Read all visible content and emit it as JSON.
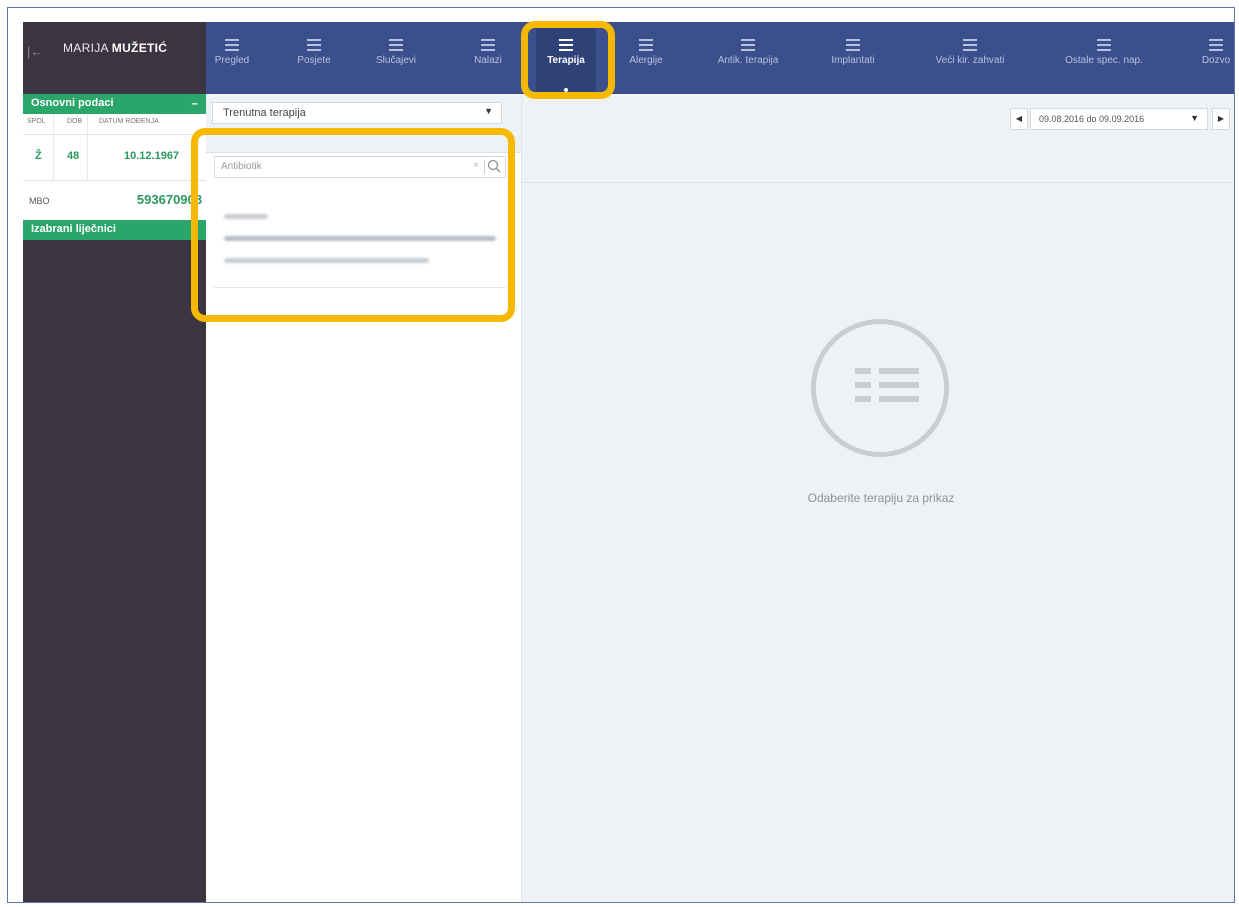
{
  "patient": {
    "first_name": "MARIJA",
    "last_name": "MUŽETIĆ"
  },
  "sidebar": {
    "basic_section": {
      "title": "Osnovni podaci",
      "toggle": "–"
    },
    "table_headers": [
      "SPOL",
      "DOB",
      "DATUM ROĐENJA"
    ],
    "sex": "Ž",
    "age": "48",
    "birth_date": "10.12.1967",
    "mbo_label": "MBO",
    "mbo_value": "593670908",
    "doctors_section": {
      "title": "Izabrani liječnici",
      "toggle": "+"
    }
  },
  "nav": {
    "items": [
      {
        "label": "Pregled",
        "icon": "list-icon"
      },
      {
        "label": "Posjete",
        "icon": "list-icon"
      },
      {
        "label": "Slučajevi",
        "icon": "list-icon"
      },
      {
        "label": "Nalazi",
        "icon": "list-icon"
      },
      {
        "label": "Terapija",
        "icon": "list-icon",
        "active": true
      },
      {
        "label": "Alergije",
        "icon": "list-icon"
      },
      {
        "label": "Antik. terapija",
        "icon": "list-icon"
      },
      {
        "label": "Implantati",
        "icon": "list-icon"
      },
      {
        "label": "Veći kir. zahvati",
        "icon": "list-icon"
      },
      {
        "label": "Ostale spec. nap.",
        "icon": "list-icon"
      },
      {
        "label": "Dozvo",
        "icon": "list-icon"
      }
    ]
  },
  "therapy_list": {
    "filter_value": "Trenutna terapija",
    "search_placeholder": "Antibiotik"
  },
  "date_filter": {
    "range": "09.08.2016 do 09.09.2016"
  },
  "empty_state": {
    "message": "Odaberite terapiju za prikaz",
    "icon": "list-icon"
  },
  "colors": {
    "nav_bg": "#3a4f8c",
    "sidebar_bg": "#3a3540",
    "accent_green": "#2aa66b",
    "highlight": "#f6b800"
  }
}
